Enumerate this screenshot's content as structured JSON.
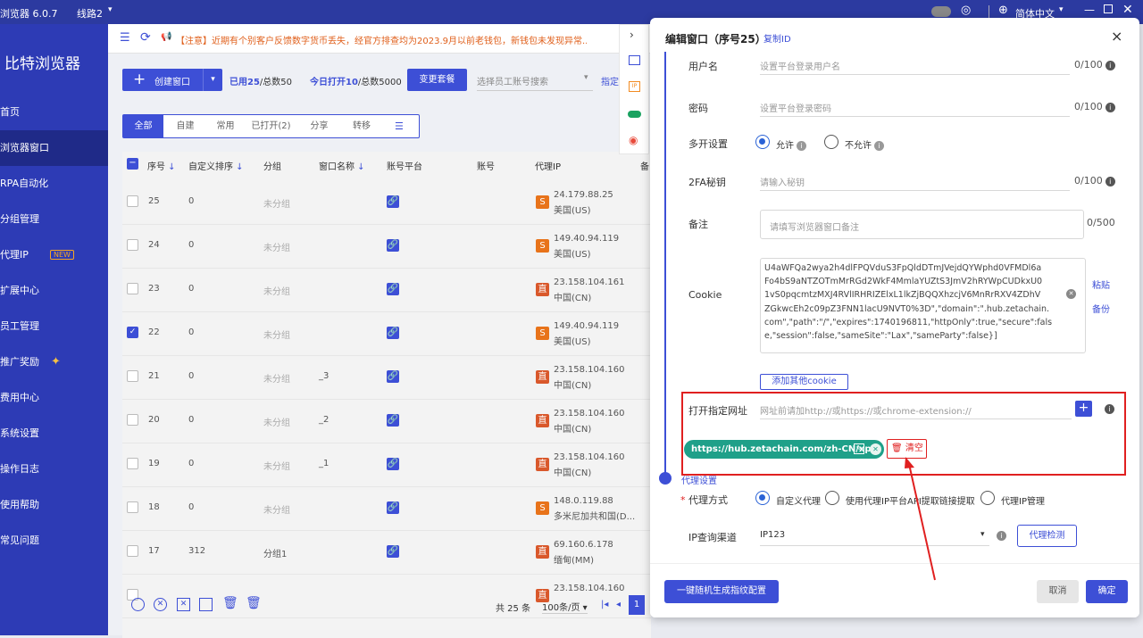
{
  "titlebar": {
    "app_title": "浏览器 6.0.7",
    "line": "线路2",
    "language": "简体中文"
  },
  "sidebar": {
    "brand": "比特浏览器",
    "items": [
      "首页",
      "浏览器窗口",
      "RPA自动化",
      "分组管理",
      "代理IP",
      "扩展中心",
      "员工管理",
      "推广奖励",
      "费用中心",
      "系统设置",
      "操作日志",
      "使用帮助",
      "常见问题"
    ],
    "new_badge": "NEW"
  },
  "notice": {
    "text": "【注意】近期有个别客户反馈数字货币丢失，经官方排查均为2023.9月以前老钱包，新钱包未发现异常..."
  },
  "toolbar": {
    "create": "创建窗口",
    "used_label": "已用25",
    "total_label": "/总数50",
    "today_label": "今日打开10",
    "today_total": "/总数5000",
    "change_plan": "变更套餐",
    "staff_placeholder": "选择员工账号搜索",
    "specify": "指定"
  },
  "tabs": [
    "全部",
    "自建",
    "常用",
    "已打开(2)",
    "分享",
    "转移"
  ],
  "table": {
    "headers": [
      "序号",
      "自定义排序",
      "分组",
      "窗口名称",
      "账号平台",
      "账号",
      "代理IP",
      "备"
    ],
    "rows": [
      {
        "id": "25",
        "sort": "0",
        "group": "未分组",
        "name": "",
        "ip": "24.179.88.25",
        "loc": "美国(US)",
        "flag": "S",
        "checked": false
      },
      {
        "id": "24",
        "sort": "0",
        "group": "未分组",
        "name": "",
        "ip": "149.40.94.119",
        "loc": "美国(US)",
        "flag": "S",
        "checked": false
      },
      {
        "id": "23",
        "sort": "0",
        "group": "未分组",
        "name": "",
        "ip": "23.158.104.161",
        "loc": "中国(CN)",
        "flag": "直",
        "checked": false
      },
      {
        "id": "22",
        "sort": "0",
        "group": "未分组",
        "name": "",
        "ip": "149.40.94.119",
        "loc": "美国(US)",
        "flag": "S",
        "checked": true
      },
      {
        "id": "21",
        "sort": "0",
        "group": "未分组",
        "name": "_3",
        "ip": "23.158.104.160",
        "loc": "中国(CN)",
        "flag": "直",
        "checked": false
      },
      {
        "id": "20",
        "sort": "0",
        "group": "未分组",
        "name": "_2",
        "ip": "23.158.104.160",
        "loc": "中国(CN)",
        "flag": "直",
        "checked": false
      },
      {
        "id": "19",
        "sort": "0",
        "group": "未分组",
        "name": "_1",
        "ip": "23.158.104.160",
        "loc": "中国(CN)",
        "flag": "直",
        "checked": false
      },
      {
        "id": "18",
        "sort": "0",
        "group": "未分组",
        "name": "",
        "ip": "148.0.119.88",
        "loc": "多米尼加共和国(D...",
        "flag": "S",
        "checked": false
      },
      {
        "id": "17",
        "sort": "312",
        "group": "分组1",
        "name": "",
        "ip": "69.160.6.178",
        "loc": "缅甸(MM)",
        "flag": "直",
        "checked": false
      },
      {
        "id": "",
        "sort": "",
        "group": "",
        "name": "",
        "ip": "23.158.104.160",
        "loc": "",
        "flag": "直",
        "checked": false
      }
    ]
  },
  "pager": {
    "total": "共 25 条",
    "per_page": "100条/页",
    "page": "1"
  },
  "dialog": {
    "title": "编辑窗口（序号25）",
    "copy_id": "复制ID",
    "close": "×",
    "username_label": "用户名",
    "username_placeholder": "设置平台登录用户名",
    "username_count": "0/100",
    "password_label": "密码",
    "password_placeholder": "设置平台登录密码",
    "password_count": "0/100",
    "multi_label": "多开设置",
    "multi_allow": "允许",
    "multi_deny": "不允许",
    "twofa_label": "2FA秘钥",
    "twofa_placeholder": "请输入秘钥",
    "twofa_count": "0/100",
    "remark_label": "备注",
    "remark_placeholder": "请填写浏览器窗口备注",
    "remark_count": "0/500",
    "cookie_label": "Cookie",
    "cookie_lines": [
      "U4aWFQa2wya2h4dlFPQVduS3FpQldDTmJVejdQYWphd0VFMDl6a",
      "Fo4bS9aNTZOTmMrRGd2WkF4MmlaYUZtS3JmV2hRYWpCUDkxU0",
      "1vS0pqcmtzMXJ4RVlIRHRIZElxL1lkZjBQQXhzcjV6MnRrRXV4ZDhV",
      "ZGkwcEh2c09pZ3FNN1lacU9NVT0%3D\",\"domain\":\".hub.zetachain.",
      "com\",\"path\":\"/\",\"expires\":1740196811,\"httpOnly\":true,\"secure\":fals",
      "e,\"session\":false,\"sameSite\":\"Lax\",\"sameParty\":false}]"
    ],
    "cookie_paste": "粘贴",
    "cookie_backup": "备份",
    "add_cookie": "添加其他cookie",
    "url_label": "打开指定网址",
    "url_placeholder": "网址前请加http://或https://或chrome-extension://",
    "url_tag": "https://hub.zetachain.com/zh-CN/xp",
    "clear": "清空",
    "proxy_section": "代理设置",
    "proxy_mode_label": "代理方式",
    "proxy_custom": "自定义代理",
    "proxy_api": "使用代理IP平台API提取链接提取",
    "proxy_mgmt": "代理IP管理",
    "ip_channel_label": "IP查询渠道",
    "ip_channel_value": "IP123",
    "proxy_check": "代理检测",
    "random_fp": "一键随机生成指纹配置",
    "cancel": "取消",
    "ok": "确定"
  },
  "colors": {
    "primary": "#3d4fd6",
    "sidebar": "#2d3bb5",
    "teal": "#1fa089",
    "highlight": "#e02020"
  }
}
